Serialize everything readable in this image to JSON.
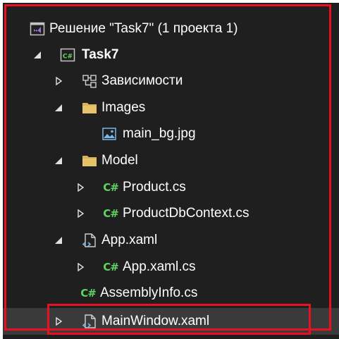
{
  "solution_explorer": {
    "items": [
      {
        "label": "Решение \"Task7\"  (1 проекта 1)",
        "icon": "solution-icon",
        "expanded": null
      },
      {
        "label": "Task7",
        "icon": "csharp-project-icon",
        "expanded": true
      },
      {
        "label": "Зависимости",
        "icon": "dependencies-icon",
        "expanded": false
      },
      {
        "label": "Images",
        "icon": "folder-icon",
        "expanded": true
      },
      {
        "label": "main_bg.jpg",
        "icon": "image-file-icon",
        "expanded": null
      },
      {
        "label": "Model",
        "icon": "folder-icon",
        "expanded": true
      },
      {
        "label": "Product.cs",
        "icon": "csharp-file-icon",
        "expanded": false
      },
      {
        "label": "ProductDbContext.cs",
        "icon": "csharp-file-icon",
        "expanded": false
      },
      {
        "label": "App.xaml",
        "icon": "xaml-file-icon",
        "expanded": true
      },
      {
        "label": "App.xaml.cs",
        "icon": "csharp-file-icon",
        "expanded": false
      },
      {
        "label": "AssemblyInfo.cs",
        "icon": "csharp-file-icon",
        "expanded": null
      },
      {
        "label": "MainWindow.xaml",
        "icon": "xaml-file-icon",
        "expanded": false
      }
    ],
    "csharp_glyph": "C#",
    "highlight_color": "#e81123"
  }
}
